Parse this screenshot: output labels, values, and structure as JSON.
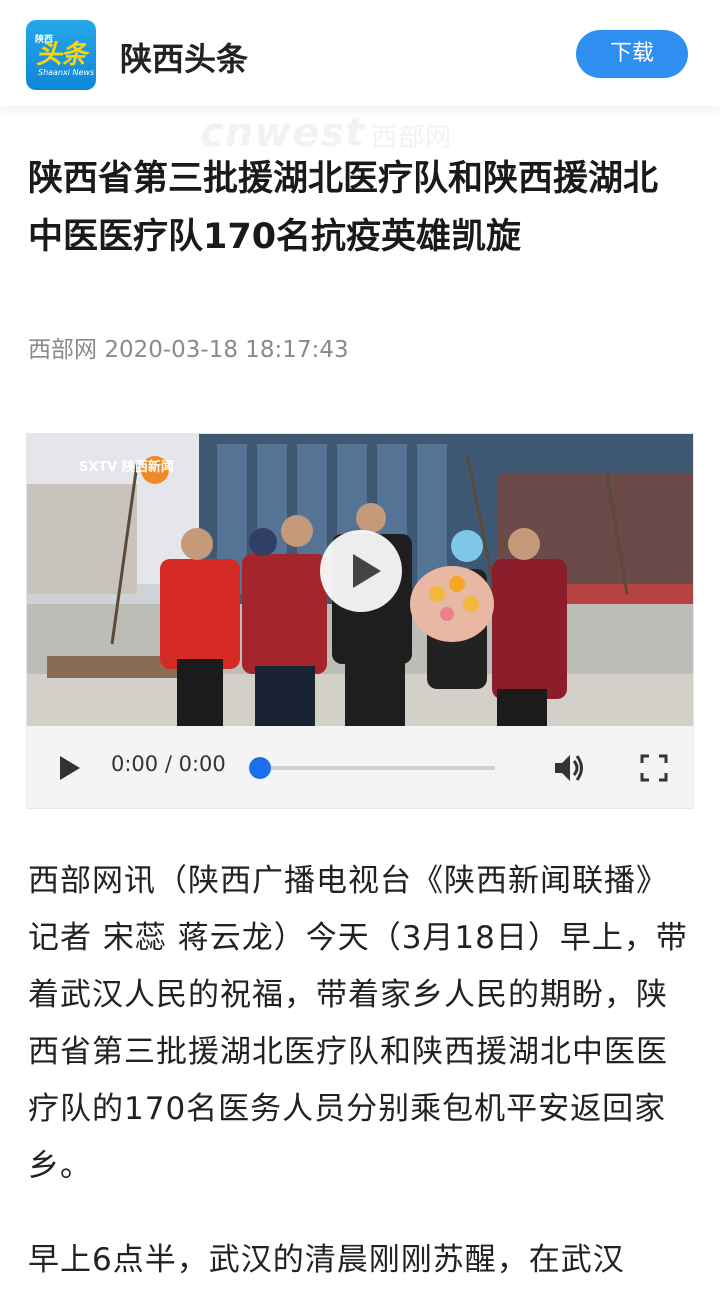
{
  "header": {
    "logo_small": "陕西",
    "logo_big": "头条",
    "logo_en": "Shaanxi News",
    "app_name": "陕西头条",
    "download_label": "下载"
  },
  "watermark": {
    "en": "cnwest",
    "cn": "西部网"
  },
  "article": {
    "title": "陕西省第三批援湖北医疗队和陕西援湖北中医医疗队170名抗疫英雄凯旋",
    "source": "西部网",
    "datetime": "2020-03-18 18:17:43",
    "video": {
      "current_time": "0:00",
      "separator": "/",
      "duration": "0:00",
      "channel_mark": "SXTV 陕西新闻",
      "progress": 0
    },
    "paragraphs": [
      "西部网讯（陕西广播电视台《陕西新闻联播》记者 宋蕊 蒋云龙）今天（3月18日）早上，带着武汉人民的祝福，带着家乡人民的期盼，陕西省第三批援湖北医疗队和陕西援湖北中医医疗队的170名医务人员分别乘包机平安返回家乡。",
      "早上6点半，武汉的清晨刚刚苏醒，在武汉"
    ]
  },
  "colors": {
    "accent": "#2e8ff0",
    "logo_bg": "#1a96e2",
    "logo_text": "#ffd400",
    "progress_knob": "#1e6ff0"
  },
  "icons": [
    "play-icon",
    "volume-icon",
    "fullscreen-icon",
    "big-play-icon"
  ]
}
